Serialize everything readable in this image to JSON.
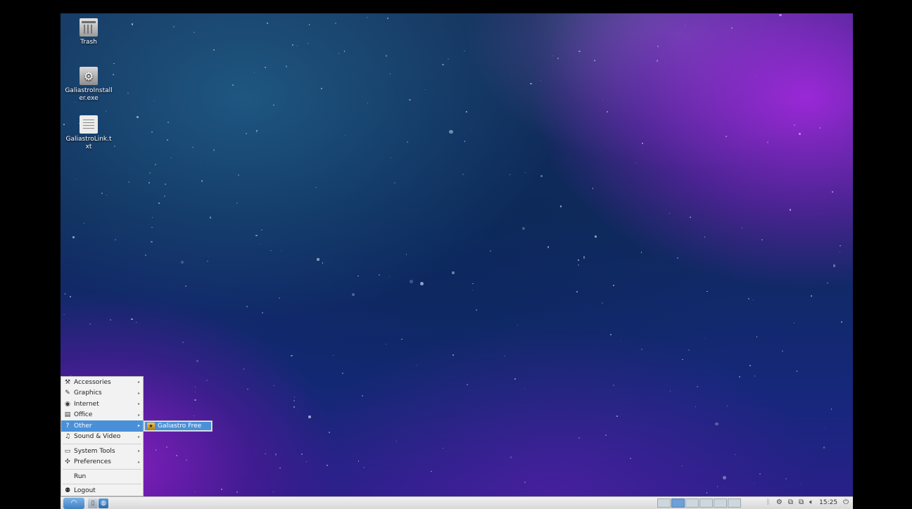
{
  "desktop": {
    "icons": [
      {
        "label": "Trash",
        "icon": "trash-icon"
      },
      {
        "label": "GaliastroInstaller.exe",
        "icon": "executable-gear-icon"
      },
      {
        "label": "GaliastroLink.txt",
        "icon": "text-file-icon"
      }
    ]
  },
  "app_menu": {
    "items": [
      {
        "label": "Accessories",
        "icon": "accessories-icon",
        "has_submenu": true
      },
      {
        "label": "Graphics",
        "icon": "graphics-icon",
        "has_submenu": true
      },
      {
        "label": "Internet",
        "icon": "internet-icon",
        "has_submenu": true
      },
      {
        "label": "Office",
        "icon": "office-icon",
        "has_submenu": true
      },
      {
        "label": "Other",
        "icon": "other-icon",
        "has_submenu": true,
        "active": true
      },
      {
        "label": "Sound & Video",
        "icon": "sound-video-icon",
        "has_submenu": true
      },
      {
        "label": "System Tools",
        "icon": "system-tools-icon",
        "has_submenu": true
      },
      {
        "label": "Preferences",
        "icon": "preferences-icon",
        "has_submenu": true
      },
      {
        "label": "Run",
        "icon": "",
        "has_submenu": false
      },
      {
        "label": "Logout",
        "icon": "logout-icon",
        "has_submenu": false
      }
    ],
    "submenu_other": [
      {
        "label": "Galiastro Free",
        "icon": "galiastro-app-icon",
        "highlighted": true
      }
    ]
  },
  "taskbar": {
    "start_icon": "start-menu-icon",
    "launchers": [
      {
        "name": "file-manager-icon"
      },
      {
        "name": "web-browser-icon"
      }
    ],
    "workspaces": 6,
    "active_workspace": 2,
    "tray_icons": [
      "bluetooth-icon",
      "network-manager-icon",
      "network-icon",
      "network-wired-icon",
      "volume-icon"
    ],
    "clock": "15:25",
    "power_icon": "power-icon"
  },
  "colors": {
    "menu_highlight": "#4a90d9",
    "menu_bg": "#f2f2f2",
    "taskbar_bg": "#e4e4e4"
  }
}
